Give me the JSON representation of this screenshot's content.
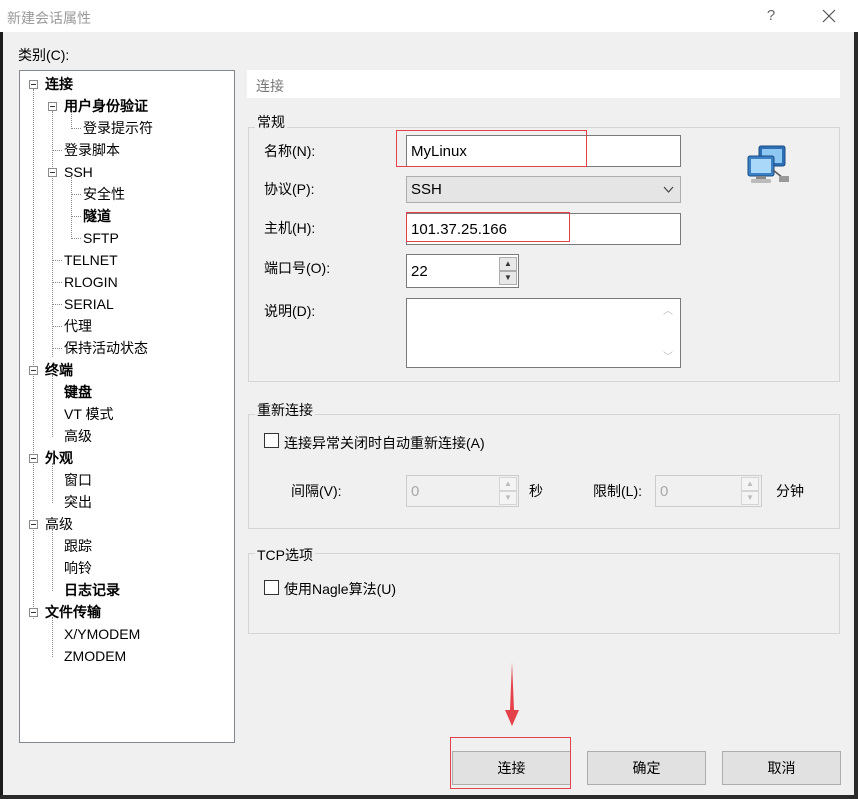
{
  "window": {
    "title": "新建会话属性",
    "help": "?"
  },
  "category_label": "类别(C):",
  "tree": {
    "items": [
      {
        "label": "连接",
        "bold": true
      },
      {
        "label": "用户身份验证",
        "bold": true
      },
      {
        "label": "登录提示符",
        "bold": false
      },
      {
        "label": "登录脚本",
        "bold": false
      },
      {
        "label": "SSH",
        "bold": false
      },
      {
        "label": "安全性",
        "bold": false
      },
      {
        "label": "隧道",
        "bold": true
      },
      {
        "label": "SFTP",
        "bold": false
      },
      {
        "label": "TELNET",
        "bold": false
      },
      {
        "label": "RLOGIN",
        "bold": false
      },
      {
        "label": "SERIAL",
        "bold": false
      },
      {
        "label": "代理",
        "bold": false
      },
      {
        "label": "保持活动状态",
        "bold": false
      },
      {
        "label": "终端",
        "bold": true
      },
      {
        "label": "键盘",
        "bold": true
      },
      {
        "label": "VT 模式",
        "bold": false
      },
      {
        "label": "高级",
        "bold": false
      },
      {
        "label": "外观",
        "bold": true
      },
      {
        "label": "窗口",
        "bold": false
      },
      {
        "label": "突出",
        "bold": false
      },
      {
        "label": "高级",
        "bold": false
      },
      {
        "label": "跟踪",
        "bold": false
      },
      {
        "label": "响铃",
        "bold": false
      },
      {
        "label": "日志记录",
        "bold": true
      },
      {
        "label": "文件传输",
        "bold": true
      },
      {
        "label": "X/YMODEM",
        "bold": false
      },
      {
        "label": "ZMODEM",
        "bold": false
      }
    ]
  },
  "panel": {
    "header": "连接",
    "general": {
      "title": "常规",
      "name_label": "名称(N):",
      "name_value": "MyLinux",
      "protocol_label": "协议(P):",
      "protocol_value": "SSH",
      "host_label": "主机(H):",
      "host_value": "101.37.25.166",
      "port_label": "端口号(O):",
      "port_value": "22",
      "desc_label": "说明(D):",
      "desc_value": "",
      "icon": "network-computers-icon"
    },
    "reconnect": {
      "title": "重新连接",
      "checkbox_label": "连接异常关闭时自动重新连接(A)",
      "checked": false,
      "interval_label": "间隔(V):",
      "interval_value": "0",
      "interval_unit": "秒",
      "limit_label": "限制(L):",
      "limit_value": "0",
      "limit_unit": "分钟"
    },
    "tcp": {
      "title": "TCP选项",
      "checkbox_label": "使用Nagle算法(U)",
      "checked": false
    }
  },
  "buttons": {
    "connect": "连接",
    "ok": "确定",
    "cancel": "取消"
  },
  "colors": {
    "annotation_red": "#e3424a",
    "accent": "#0078d7"
  }
}
